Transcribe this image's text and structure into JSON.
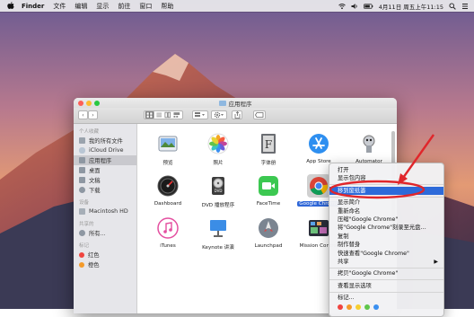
{
  "menubar": {
    "items": [
      "Finder",
      "文件",
      "编辑",
      "显示",
      "前往",
      "窗口",
      "帮助"
    ],
    "datetime": "4月11日 周五上午11:15"
  },
  "window": {
    "title": "应用程序",
    "toolbar": {
      "back": "‹",
      "forward": "›"
    }
  },
  "sidebar": {
    "favorites_heading": "个人收藏",
    "favorites": [
      "我的所有文件",
      "iCloud Drive",
      "应用程序",
      "桌面",
      "文稿",
      "下载"
    ],
    "devices_heading": "设备",
    "devices": [
      "Macintosh HD"
    ],
    "shared_heading": "共享的",
    "shared": [
      "所有..."
    ],
    "tags_heading": "标记",
    "tags": [
      {
        "label": "红色",
        "color": "#f0443f"
      },
      {
        "label": "橙色",
        "color": "#f49a2a"
      }
    ]
  },
  "apps": [
    {
      "label": "预览",
      "icon": "preview-icon"
    },
    {
      "label": "照片",
      "icon": "photos-icon"
    },
    {
      "label": "字体册",
      "icon": "font-book-icon"
    },
    {
      "label": "App Store",
      "icon": "app-store-icon"
    },
    {
      "label": "Automator",
      "icon": "automator-icon"
    },
    {
      "label": "Dashboard",
      "icon": "dashboard-icon"
    },
    {
      "label": "DVD 播放程序",
      "icon": "dvd-player-icon"
    },
    {
      "label": "FaceTime",
      "icon": "facetime-icon"
    },
    {
      "label": "Google Chrome",
      "icon": "chrome-icon"
    },
    {
      "label": "",
      "icon": ""
    },
    {
      "label": "iTunes",
      "icon": "itunes-icon"
    },
    {
      "label": "Keynote 讲演",
      "icon": "keynote-icon"
    },
    {
      "label": "Launchpad",
      "icon": "launchpad-icon"
    },
    {
      "label": "Mission Control",
      "icon": "mission-control-icon"
    },
    {
      "label": "",
      "icon": ""
    }
  ],
  "context_menu": {
    "items": [
      {
        "label": "打开"
      },
      {
        "label": "显示包内容"
      },
      {
        "label": "移到废纸篓",
        "highlighted": true
      },
      {
        "label": "显示简介"
      },
      {
        "label": "重新命名"
      },
      {
        "label": "压缩\"Google Chrome\""
      },
      {
        "label": "将\"Google Chrome\"刻录至光盘…"
      },
      {
        "label": "复制"
      },
      {
        "label": "制作替身"
      },
      {
        "label": "快速查看\"Google Chrome\""
      },
      {
        "label": "共享",
        "submenu": true
      },
      {
        "label": "拷贝\"Google Chrome\""
      },
      {
        "label": "查看显示选项"
      },
      {
        "label": "标记..."
      }
    ],
    "tag_colors": [
      "#f0443f",
      "#f49a2a",
      "#f6cf2f",
      "#5fc64b",
      "#3a8ff0",
      "#b064d8",
      "#9a9a9a"
    ]
  },
  "colors": {
    "selection": "#2d6ad9",
    "annotation": "#e0262b"
  }
}
